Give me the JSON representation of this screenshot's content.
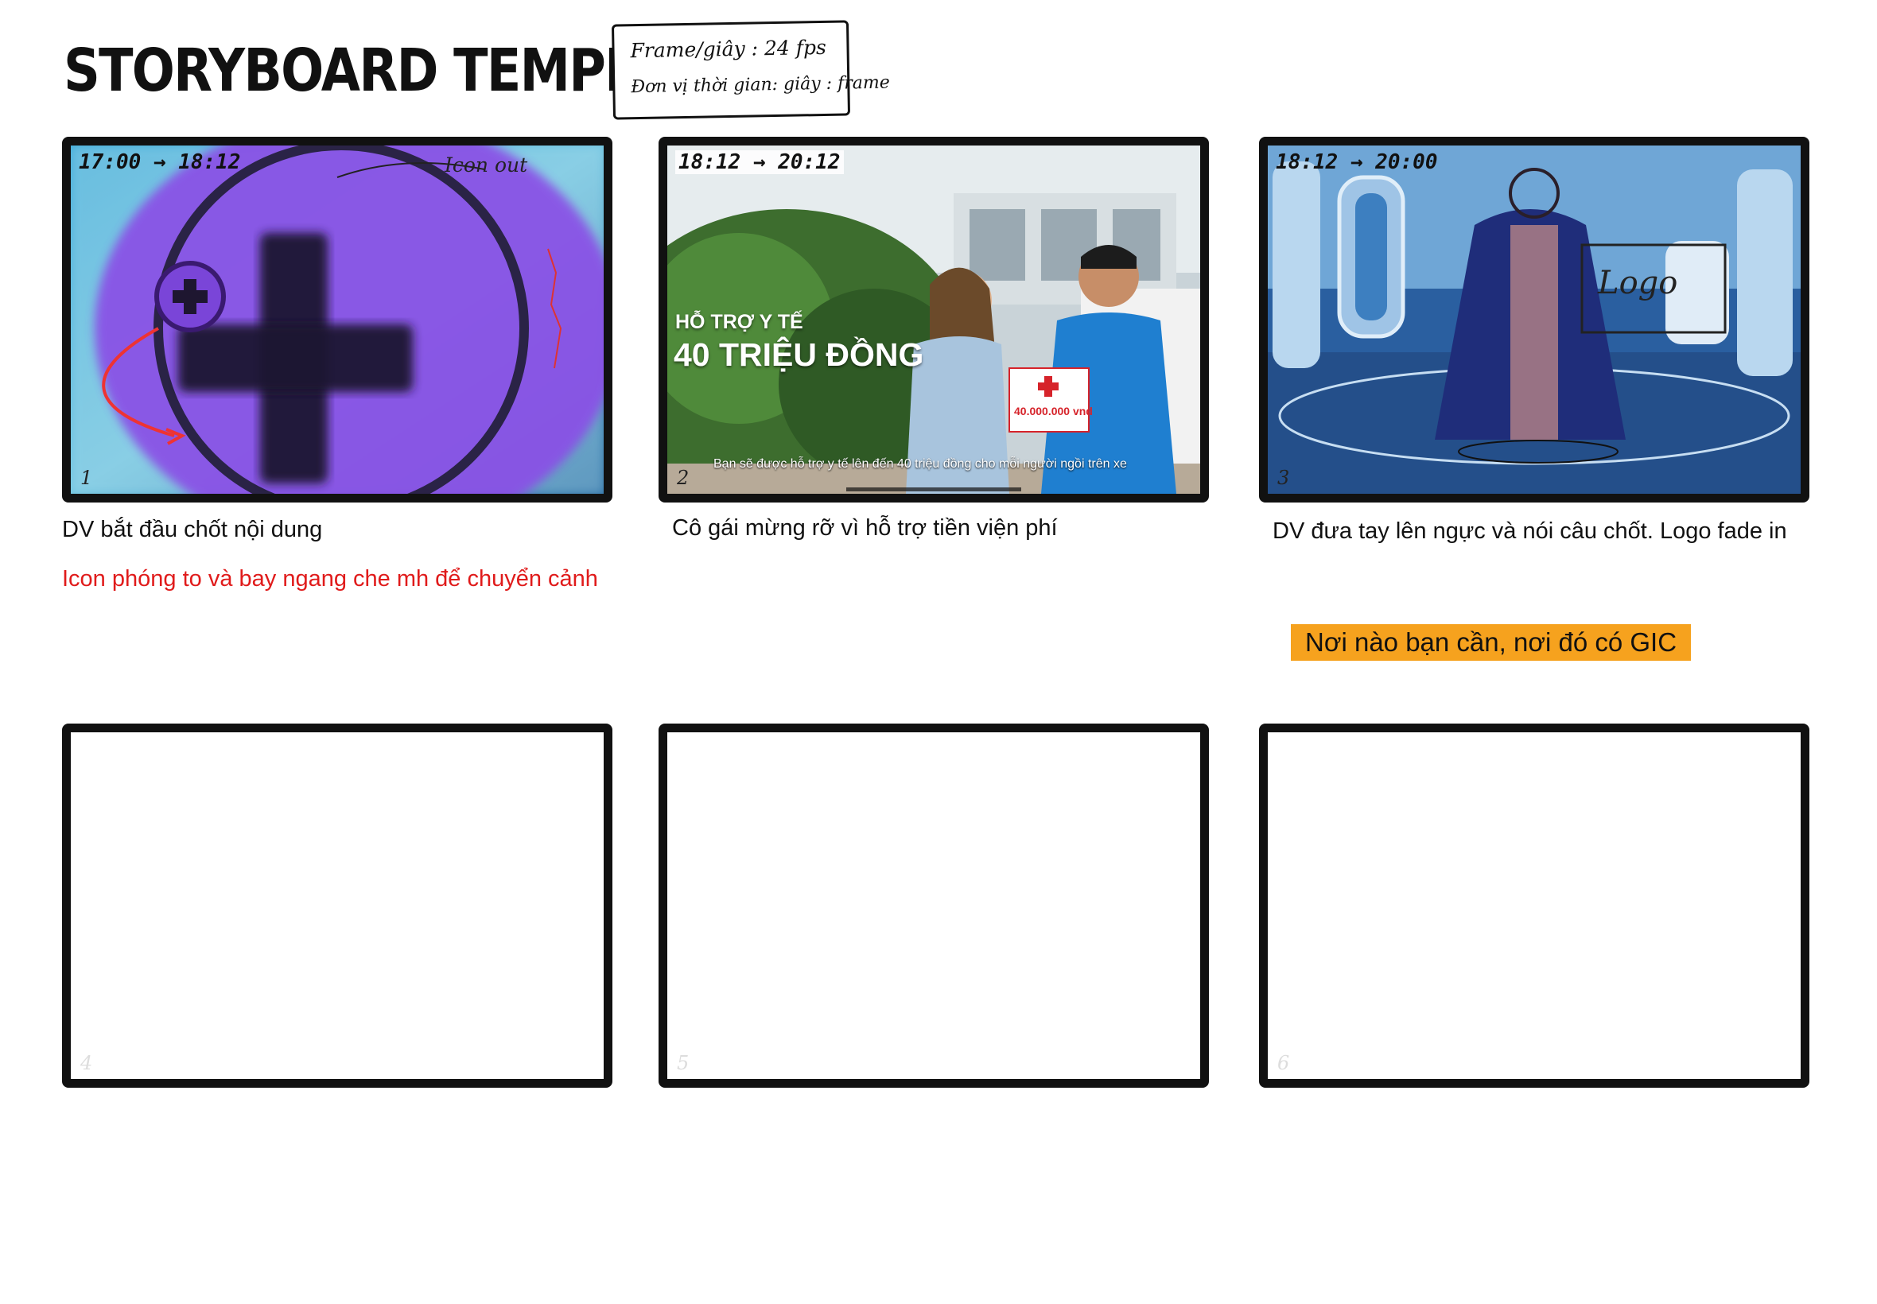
{
  "header": {
    "title": "STORYBOARD TEMPLATE",
    "notes": [
      "Frame/giây : 24 fps",
      "Đơn vị thời gian: giây : frame"
    ]
  },
  "frames": [
    {
      "number": "1",
      "timecode": "17:00 → 18:12",
      "annotation": "Icon out",
      "caption": "DV bắt đầu chốt nội dung",
      "note": "Icon phóng to và bay ngang che mh để chuyển cảnh"
    },
    {
      "number": "2",
      "timecode": "18:12 → 20:12",
      "overlay_line1": "HỖ TRỢ Y TẾ",
      "overlay_line2": "40 TRIỆU ĐỒNG",
      "sign": "40.000.000 vnd",
      "subtitle": "Bạn sẽ được hỗ trợ y tế lên đến 40 triệu đồng cho mỗi người ngồi trên xe",
      "caption": "Cô gái mừng rỡ vì hỗ trợ tiền viện phí"
    },
    {
      "number": "3",
      "timecode": "18:12 → 20:00",
      "logo_sketch": "Logo",
      "caption": "DV đưa tay lên ngực và nói câu chốt. Logo fade in",
      "slogan": "Nơi nào bạn cần, nơi đó có GIC"
    },
    {
      "number": "4"
    },
    {
      "number": "5"
    },
    {
      "number": "6"
    }
  ],
  "colors": {
    "accent_red": "#e01b1b",
    "slogan_bg": "#f6a21e",
    "purple_icon": "#7b3fe0"
  }
}
